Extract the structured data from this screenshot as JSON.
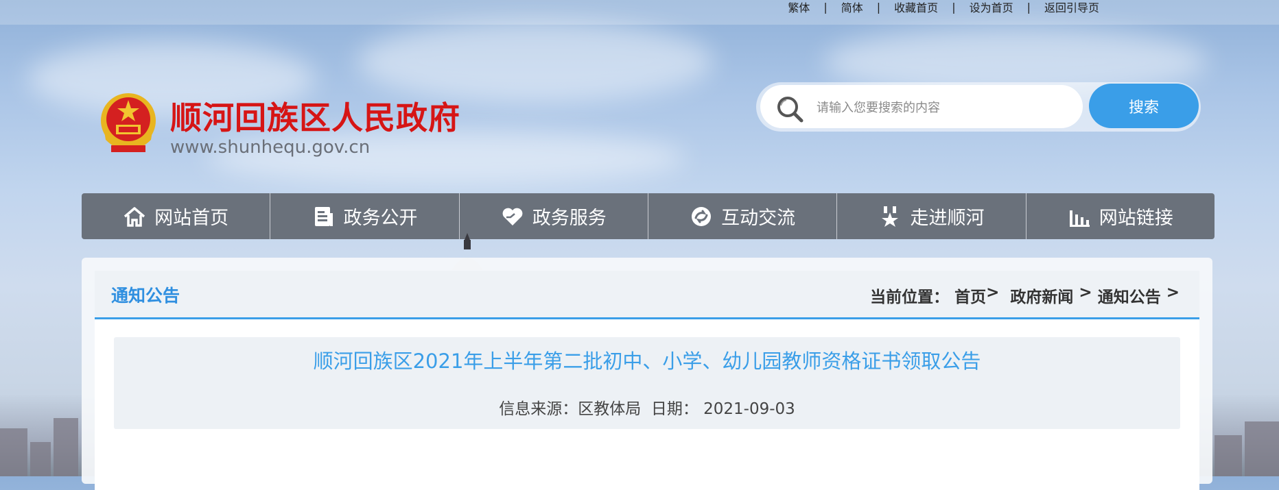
{
  "topbar": {
    "links": [
      "繁体",
      "简体",
      "收藏首页",
      "设为首页",
      "返回引导页"
    ],
    "separator": "|"
  },
  "header": {
    "site_title": "顺河回族区人民政府",
    "site_url": "www.shunhequ.gov.cn",
    "emblem_icon": "national-emblem-icon"
  },
  "search": {
    "placeholder": "请输入您要搜索的内容",
    "button_label": "搜索",
    "accent_color": "#3a9ee8"
  },
  "nav": {
    "items": [
      {
        "label": "网站首页",
        "icon": "home-icon"
      },
      {
        "label": "政务公开",
        "icon": "document-icon"
      },
      {
        "label": "政务服务",
        "icon": "service-heart-icon"
      },
      {
        "label": "互动交流",
        "icon": "exchange-icon"
      },
      {
        "label": "走进顺河",
        "icon": "star-badge-icon"
      },
      {
        "label": "网站链接",
        "icon": "bar-chart-icon"
      }
    ]
  },
  "main": {
    "section_title": "通知公告",
    "breadcrumb": {
      "prefix": "当前位置：",
      "items": [
        "首页",
        "政府新闻",
        "通知公告"
      ],
      "separator": ">"
    },
    "article": {
      "title": "顺河回族区2021年上半年第二批初中、小学、幼儿园教师资格证书领取公告",
      "source_label": "信息来源：",
      "source": "区教体局",
      "date_label": "日期：",
      "date": "2021-09-03"
    }
  },
  "colors": {
    "title_red": "#d61515",
    "nav_bg": "#6a717b",
    "link_blue": "#3a9ee8"
  }
}
